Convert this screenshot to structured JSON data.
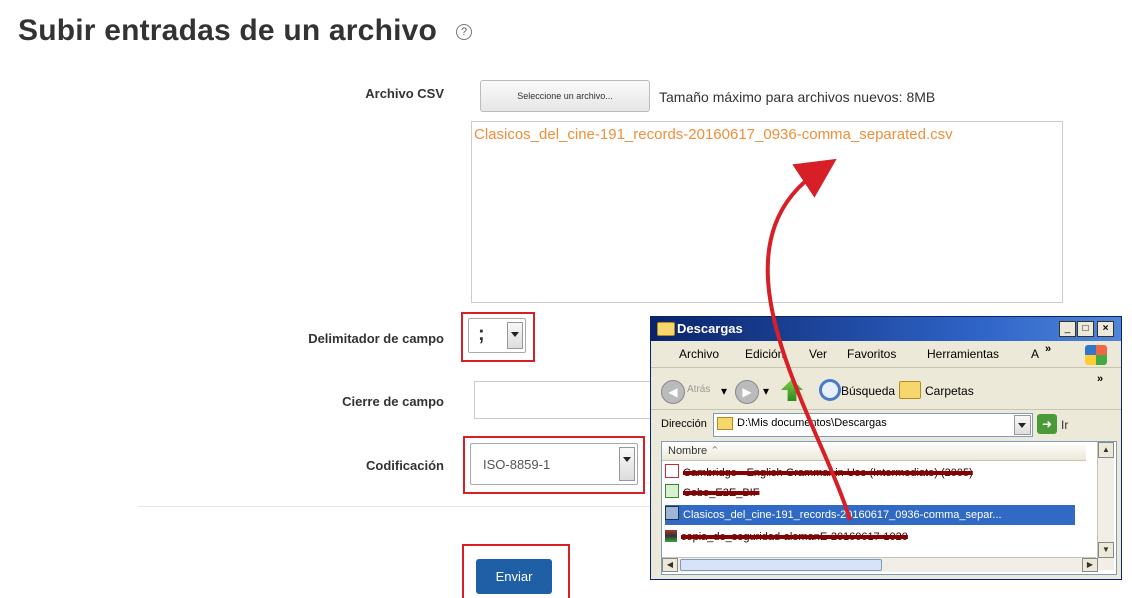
{
  "page": {
    "title": "Subir entradas de un archivo",
    "help_icon": "question-circle-icon"
  },
  "form": {
    "csv_label": "Archivo CSV",
    "choose_button": "Seleccione un archivo...",
    "max_size": "Tamaño máximo para archivos nuevos: 8MB",
    "selected_file": "Clasicos_del_cine-191_records-20160617_0936-comma_separated.csv",
    "delimiter_label": "Delimitador de campo",
    "delimiter_value": ";",
    "enclosure_label": "Cierre de campo",
    "enclosure_value": "",
    "encoding_label": "Codificación",
    "encoding_value": "ISO-8859-1",
    "submit_label": "Enviar"
  },
  "explorer": {
    "title": "Descargas",
    "menu": [
      "Archivo",
      "Edición",
      "Ver",
      "Favoritos",
      "Herramientas",
      "A"
    ],
    "menu_more": "»",
    "toolbar": {
      "back": "Atrás",
      "search": "Búsqueda",
      "folders": "Carpetas",
      "more": "»"
    },
    "address_label": "Dirección",
    "address_value": "D:\\Mis documentos\\Descargas",
    "go_label": "Ir",
    "column_name": "Nombre",
    "files": [
      {
        "name": "Cambridge - English Grammar in Use (Intermediate) (2005)",
        "struck": true
      },
      {
        "name": "Cobo_E2E_BIF",
        "struck": true
      },
      {
        "name": "Clasicos_del_cine-191_records-20160617_0936-comma_separ...",
        "struck": false,
        "selected": true
      },
      {
        "name": "copia_de_seguridad-alemanE-20160617-1020",
        "struck": true
      }
    ]
  },
  "colors": {
    "highlight": "#d61f26",
    "filename": "#ef8f3a",
    "submit": "#1f5fa6",
    "xp_titlebar": "#0a246a"
  }
}
